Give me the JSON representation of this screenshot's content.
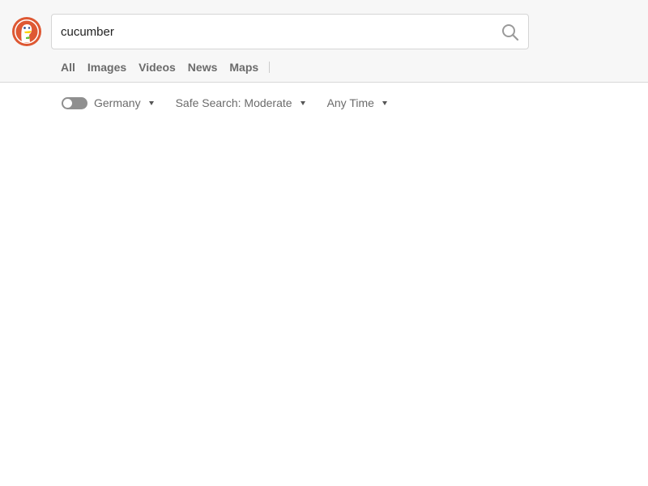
{
  "search": {
    "value": "cucumber",
    "placeholder": ""
  },
  "icons": {
    "logo": "duckduckgo-logo",
    "search": "search-icon",
    "dropdown": "caret-down-icon"
  },
  "tabs": [
    {
      "label": "All"
    },
    {
      "label": "Images"
    },
    {
      "label": "Videos"
    },
    {
      "label": "News"
    },
    {
      "label": "Maps"
    }
  ],
  "filters": {
    "region_toggle": {
      "on": false
    },
    "region": "Germany",
    "safe_search": "Safe Search: Moderate",
    "time": "Any Time"
  },
  "colors": {
    "header_bg": "#f7f7f7",
    "logo_red": "#de5833",
    "text_gray": "#6b6b6b"
  }
}
